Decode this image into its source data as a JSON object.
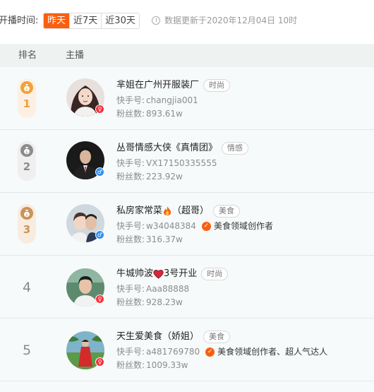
{
  "filter": {
    "label": "开播时间:",
    "options": [
      "昨天",
      "近7天",
      "近30天"
    ],
    "selected": "昨天",
    "update_text": "数据更新于2020年12月04日 10时"
  },
  "table": {
    "headers": {
      "rank": "排名",
      "anchor": "主播"
    },
    "rows": [
      {
        "rank": "1",
        "name": "芈姐在广州开服装厂",
        "tag": "时尚",
        "id_label": "快手号:",
        "id_value": "changjia001",
        "fans_label": "粉丝数:",
        "fans_value": "893.61w",
        "gender": "♀",
        "cert": ""
      },
      {
        "rank": "2",
        "name": "丛哥情感大侠《真情团》",
        "tag": "情感",
        "id_label": "快手号:",
        "id_value": "VX17150335555",
        "fans_label": "粉丝数:",
        "fans_value": "223.92w",
        "gender": "♂",
        "cert": ""
      },
      {
        "rank": "3",
        "name": "私房家常菜",
        "name_suffix": "（超哥）",
        "tag": "美食",
        "id_label": "快手号:",
        "id_value": "w34048384",
        "fans_label": "粉丝数:",
        "fans_value": "316.37w",
        "gender": "♂",
        "cert": "美食领域创作者"
      },
      {
        "rank": "4",
        "name": "牛城帅波",
        "name_suffix": "3号开业",
        "tag": "时尚",
        "id_label": "快手号:",
        "id_value": "Aaa88888",
        "fans_label": "粉丝数:",
        "fans_value": "928.23w",
        "gender": "♀",
        "cert": ""
      },
      {
        "rank": "5",
        "name": "天生爱美食（娇姐）",
        "tag": "美食",
        "id_label": "快手号:",
        "id_value": "a481769780",
        "fans_label": "粉丝数:",
        "fans_value": "1009.33w",
        "gender": "♀",
        "cert": "美食领域创作者、超人气达人"
      }
    ]
  },
  "colors": {
    "accent": "#fa5e0f",
    "gold": "#f0a23a",
    "silver": "#8c8c8c",
    "bronze": "#c9935a"
  },
  "icons": {
    "update": "clock-icon",
    "medal": "money-bag-icon",
    "female": "female-icon",
    "male": "male-icon",
    "certified": "check-badge-icon",
    "fire": "fire-emoji",
    "heart": "heart-emoji"
  }
}
